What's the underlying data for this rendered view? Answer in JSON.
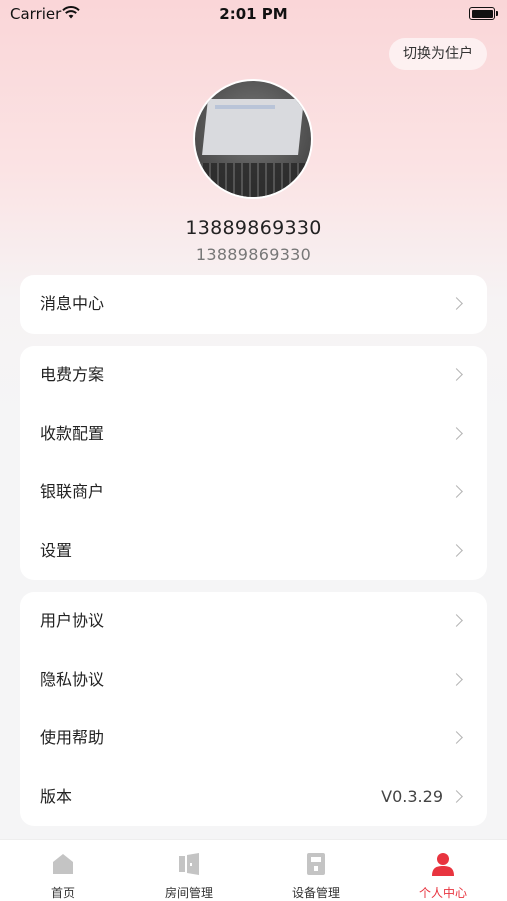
{
  "status_bar": {
    "carrier": "Carrier",
    "time": "2:01 PM"
  },
  "header": {
    "switch_label": "切换为住户"
  },
  "profile": {
    "name": "13889869330",
    "phone": "13889869330"
  },
  "groups": [
    {
      "items": [
        {
          "label": "消息中心"
        }
      ]
    },
    {
      "items": [
        {
          "label": "电费方案"
        },
        {
          "label": "收款配置"
        },
        {
          "label": "银联商户"
        },
        {
          "label": "设置"
        }
      ]
    },
    {
      "items": [
        {
          "label": "用户协议"
        },
        {
          "label": "隐私协议"
        },
        {
          "label": "使用帮助"
        },
        {
          "label": "版本",
          "value": "V0.3.29"
        }
      ]
    }
  ],
  "tabbar": {
    "items": [
      {
        "label": "首页",
        "icon": "home-icon"
      },
      {
        "label": "房间管理",
        "icon": "door-icon"
      },
      {
        "label": "设备管理",
        "icon": "meter-icon"
      },
      {
        "label": "个人中心",
        "icon": "person-icon",
        "active": true
      }
    ]
  },
  "colors": {
    "accent": "#e8343f",
    "inactive_icon": "#c4c4c4",
    "background_top": "#fad6d8"
  }
}
